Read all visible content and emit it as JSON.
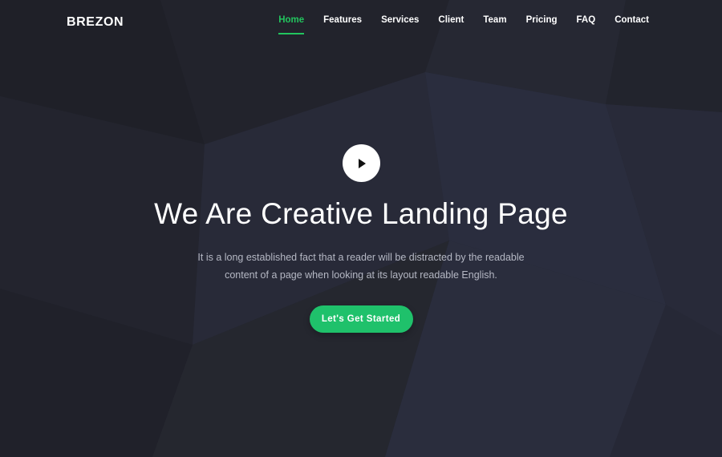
{
  "brand": {
    "name": "BREZON"
  },
  "nav": {
    "items": [
      {
        "label": "Home",
        "active": true
      },
      {
        "label": "Features",
        "active": false
      },
      {
        "label": "Services",
        "active": false
      },
      {
        "label": "Client",
        "active": false
      },
      {
        "label": "Team",
        "active": false
      },
      {
        "label": "Pricing",
        "active": false
      },
      {
        "label": "FAQ",
        "active": false
      },
      {
        "label": "Contact",
        "active": false
      }
    ]
  },
  "hero": {
    "play_icon": "play-icon",
    "headline": "We Are Creative Landing Page",
    "subtext": "It is a long established fact that a reader will be distracted by the readable content of a page when looking at its layout readable English.",
    "cta_label": "Let's Get Started"
  },
  "colors": {
    "accent": "#1fc16b",
    "background": "#252733",
    "text": "#ffffff",
    "muted_text": "#b5b8c4"
  }
}
